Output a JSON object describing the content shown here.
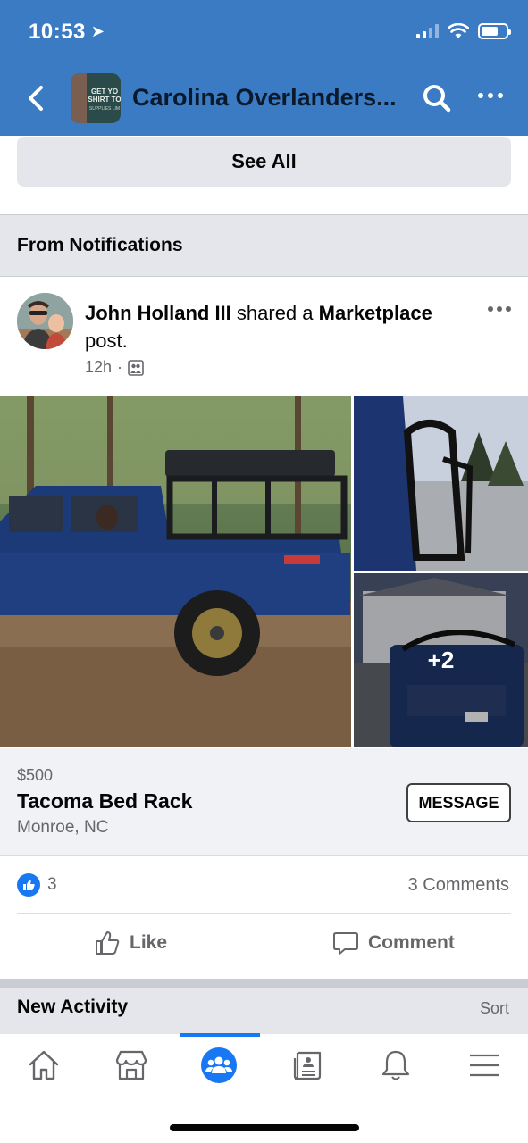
{
  "status_bar": {
    "time": "10:53"
  },
  "header": {
    "group_name": "Carolina Overlanders...",
    "group_thumb_text": "GET YO SHIRT TO",
    "group_thumb_subtext": "SUPPLIES LIM"
  },
  "see_all_label": "See All",
  "section_notifications": "From Notifications",
  "post": {
    "author": "John Holland III",
    "action_text": " shared a ",
    "target": "Marketplace",
    "target_suffix": " post.",
    "time": "12h",
    "separator": "·",
    "more_photos": "+2",
    "listing": {
      "price": "$500",
      "title": "Tacoma Bed Rack",
      "location": "Monroe, NC",
      "message_label": "MESSAGE"
    },
    "reaction_count": "3",
    "comments_count": "3 Comments",
    "like_label": "Like",
    "comment_label": "Comment"
  },
  "new_activity": {
    "title": "New Activity",
    "sort_label": "Sort"
  },
  "tabs": [
    "home",
    "marketplace",
    "groups",
    "news",
    "notifications",
    "menu"
  ],
  "colors": {
    "header_bg": "#3b7bc4",
    "accent": "#1877f2",
    "grey_text": "#65676b"
  }
}
